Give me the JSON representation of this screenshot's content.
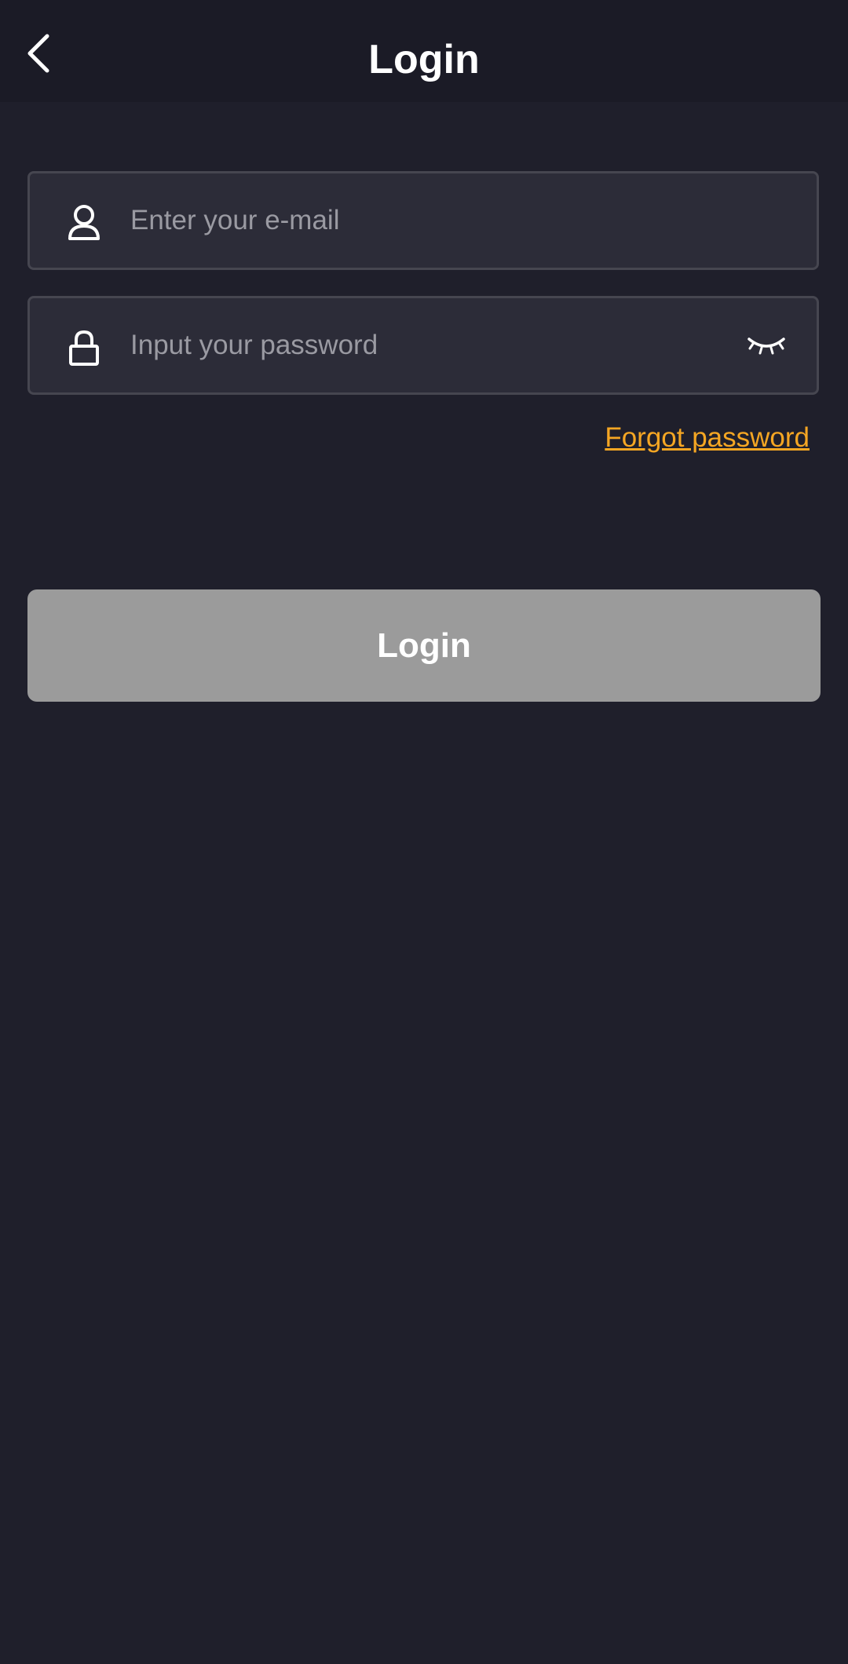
{
  "header": {
    "title": "Login",
    "back_icon": "chevron-left-icon"
  },
  "form": {
    "email": {
      "icon": "user-icon",
      "placeholder": "Enter your e-mail",
      "value": ""
    },
    "password": {
      "icon": "lock-icon",
      "placeholder": "Input your password",
      "value": "",
      "toggle_icon": "eye-closed-icon"
    },
    "forgot_label": "Forgot password",
    "submit_label": "Login"
  },
  "colors": {
    "background": "#1f1f2b",
    "header_background": "#1b1b26",
    "field_background": "#2c2c38",
    "field_border": "#464650",
    "link": "#f5a623",
    "button_disabled": "#9b9b9b",
    "placeholder": "#9a9aa2"
  }
}
